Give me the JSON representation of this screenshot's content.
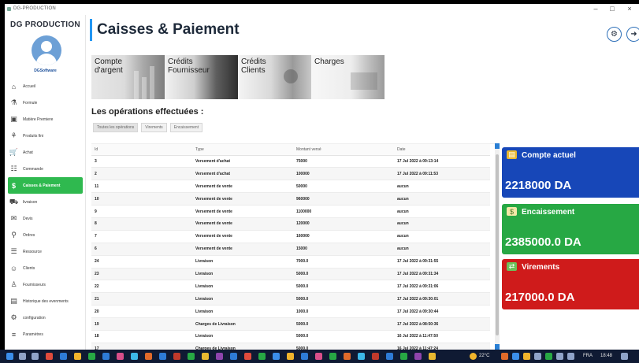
{
  "window": {
    "title": "DG-PRODUCTION",
    "controls": [
      "–",
      "□",
      "×"
    ]
  },
  "sidebar": {
    "brand": "DG PRODUCTION",
    "user": "DGSoftware",
    "items": [
      {
        "label": "Accueil",
        "icon": "home-icon",
        "glyph": "⌂"
      },
      {
        "label": "Formule",
        "icon": "formula-icon",
        "glyph": "⚗"
      },
      {
        "label": "Matière Premiere",
        "icon": "box-icon",
        "glyph": "▣"
      },
      {
        "label": "Produits fini",
        "icon": "product-icon",
        "glyph": "⚘"
      },
      {
        "label": "Achat",
        "icon": "cart-icon",
        "glyph": "🛒"
      },
      {
        "label": "Commande",
        "icon": "order-icon",
        "glyph": "☷"
      },
      {
        "label": "Caisses & Paiement",
        "icon": "cash-register-icon",
        "glyph": "$",
        "active": true
      },
      {
        "label": "livraison",
        "icon": "truck-icon",
        "glyph": "⛟"
      },
      {
        "label": "Devis",
        "icon": "quote-icon",
        "glyph": "✉"
      },
      {
        "label": "Ordres",
        "icon": "search-icon",
        "glyph": "⚲"
      },
      {
        "label": "Ressource",
        "icon": "resource-icon",
        "glyph": "☰"
      },
      {
        "label": "Clients",
        "icon": "clients-icon",
        "glyph": "☺"
      },
      {
        "label": "Fournisseurs",
        "icon": "supplier-icon",
        "glyph": "♙"
      },
      {
        "label": "Historique des evenments",
        "icon": "history-icon",
        "glyph": "▤"
      },
      {
        "label": "configuration",
        "icon": "gear-icon",
        "glyph": "⚙"
      },
      {
        "label": "Paramètres",
        "icon": "settings-icon",
        "glyph": "≡"
      }
    ]
  },
  "header": {
    "title": "Caisses & Paiement",
    "buttons": [
      {
        "icon": "settings-icon",
        "glyph": "⚙"
      },
      {
        "icon": "logout-icon",
        "glyph": "➜"
      }
    ]
  },
  "tiles": [
    {
      "label": "Compte\nd'argent"
    },
    {
      "label": "Crédits\nFournisseur"
    },
    {
      "label": "Crédits\nClients"
    },
    {
      "label": "Charges"
    }
  ],
  "operations": {
    "title": "Les opérations effectuées :",
    "filters": [
      "Toutes les opérations",
      "Virements",
      "Encaissement"
    ],
    "columns": [
      "Id",
      "Type",
      "Montant versé",
      "Date"
    ],
    "rows": [
      [
        "3",
        "Versement d'achat",
        "75000",
        "17 Jul 2022 à 09:13:14"
      ],
      [
        "2",
        "Versement d'achat",
        "100000",
        "17 Jul 2022 à 09:11:53"
      ],
      [
        "11",
        "Versement de vente",
        "50000",
        "aucun"
      ],
      [
        "10",
        "Versement de vente",
        "960000",
        "aucun"
      ],
      [
        "9",
        "Versement de vente",
        "1100000",
        "aucun"
      ],
      [
        "8",
        "Versement de vente",
        "120000",
        "aucun"
      ],
      [
        "7",
        "Versement de vente",
        "160000",
        "aucun"
      ],
      [
        "6",
        "Versement de vente",
        "15000",
        "aucun"
      ],
      [
        "24",
        "Livraison",
        "7000.0",
        "17 Jul 2022 à 09:31:55"
      ],
      [
        "23",
        "Livraison",
        "5000.0",
        "17 Jul 2022 à 09:31:34"
      ],
      [
        "22",
        "Livraison",
        "5000.0",
        "17 Jul 2022 à 09:31:06"
      ],
      [
        "21",
        "Livraison",
        "5000.0",
        "17 Jul 2022 à 09:30:01"
      ],
      [
        "20",
        "Livraison",
        "1000.0",
        "17 Jul 2022 à 09:30:44"
      ],
      [
        "19",
        "Charges de Livraison",
        "5000.0",
        "17 Jul 2022 à 08:50:36"
      ],
      [
        "18",
        "Livraison",
        "5000.0",
        "16 Jul 2022 à 11:47:50"
      ],
      [
        "17",
        "Charges de Livraison",
        "5000.0",
        "16 Jul 2022 à 11:47:24"
      ]
    ]
  },
  "cards": [
    {
      "title": "Compte actuel",
      "value": "2218000 DA",
      "color": "#1747b8",
      "icon": "wallet-icon",
      "glyph": "▤"
    },
    {
      "title": "Encaissement",
      "value": "2385000.0 DA",
      "color": "#27a844",
      "icon": "cash-in-icon",
      "glyph": "$"
    },
    {
      "title": "Virements",
      "value": "217000.0 DA",
      "color": "#cf1b1b",
      "icon": "transfer-icon",
      "glyph": "⇄"
    }
  ],
  "taskbar": {
    "weather": "22°C",
    "lang": "FRA",
    "time": "18:48"
  }
}
